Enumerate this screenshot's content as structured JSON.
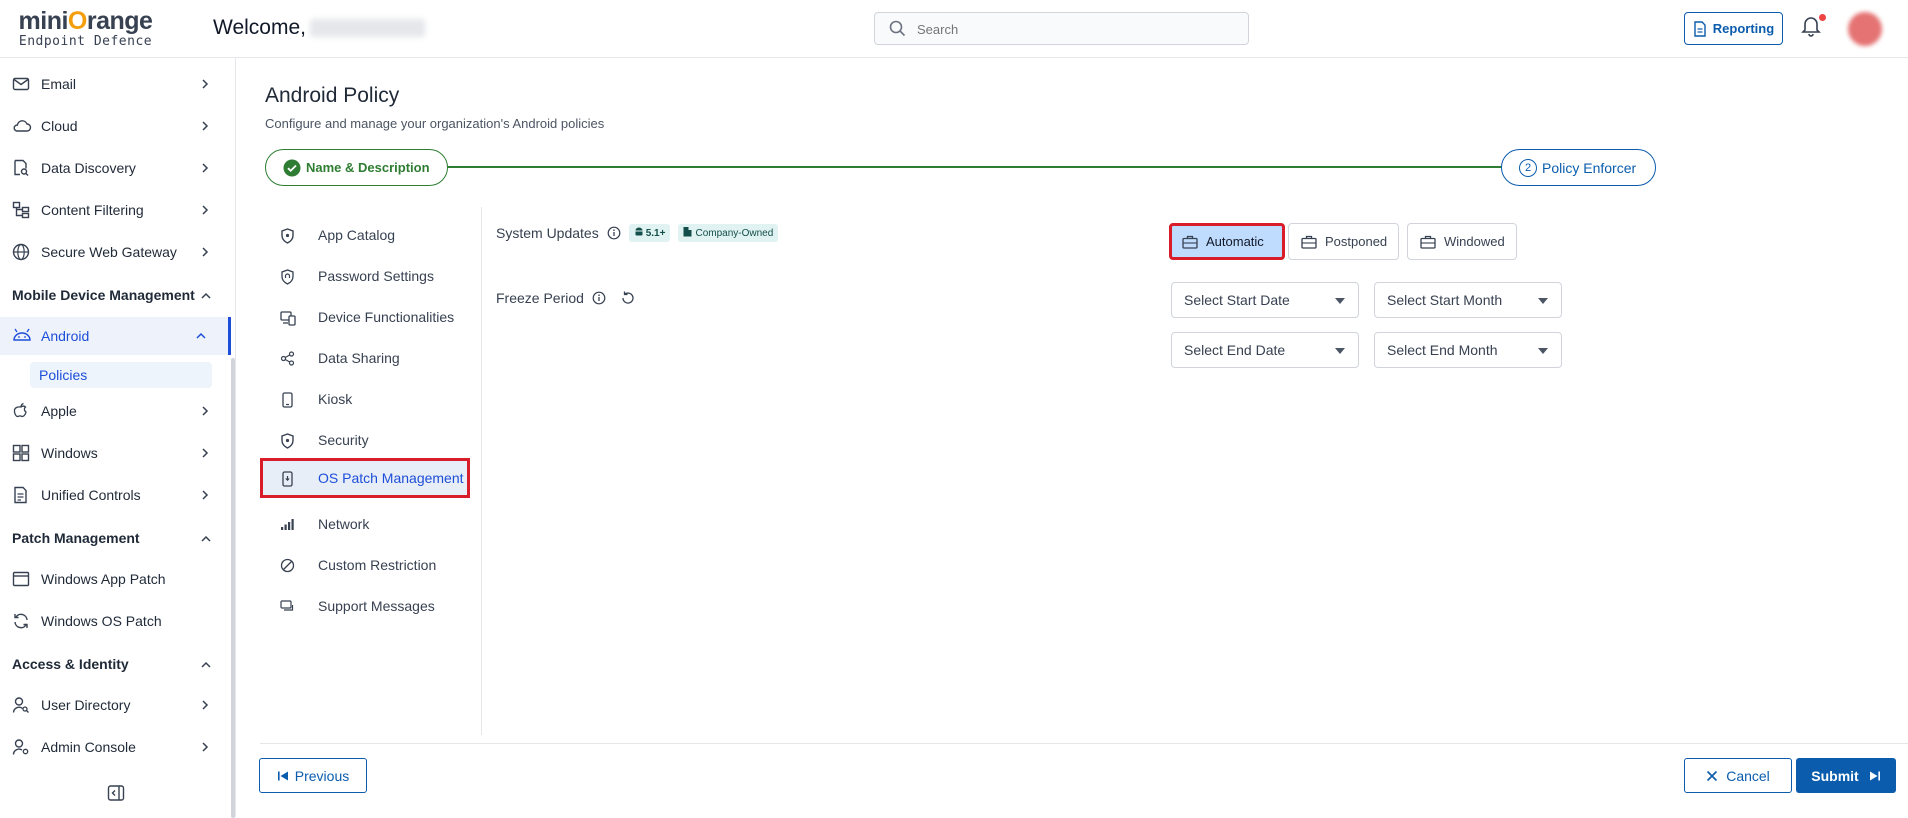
{
  "header": {
    "logo_main_a": "mini",
    "logo_main_o": "O",
    "logo_main_b": "range",
    "logo_sub": "Endpoint Defence",
    "welcome": "Welcome,",
    "search_placeholder": "Search",
    "reporting_label": "Reporting"
  },
  "sidebar": {
    "items_top": [
      {
        "label": "Email",
        "icon": "mail-icon"
      },
      {
        "label": "Cloud",
        "icon": "cloud-icon"
      },
      {
        "label": "Data Discovery",
        "icon": "data-discovery-icon"
      },
      {
        "label": "Content Filtering",
        "icon": "content-filter-icon"
      },
      {
        "label": "Secure Web Gateway",
        "icon": "globe-icon"
      }
    ],
    "section_mdm": "Mobile Device Management",
    "android_label": "Android",
    "policies_label": "Policies",
    "mdm_items": [
      {
        "label": "Apple",
        "icon": "apple-icon"
      },
      {
        "label": "Windows",
        "icon": "windows-icon"
      },
      {
        "label": "Unified Controls",
        "icon": "unified-controls-icon"
      }
    ],
    "section_patch": "Patch Management",
    "patch_items": [
      {
        "label": "Windows App Patch",
        "icon": "app-window-icon"
      },
      {
        "label": "Windows OS Patch",
        "icon": "refresh-icon"
      }
    ],
    "section_access": "Access & Identity",
    "access_items": [
      {
        "label": "User Directory",
        "icon": "user-directory-icon"
      },
      {
        "label": "Admin Console",
        "icon": "admin-console-icon"
      }
    ]
  },
  "page": {
    "title": "Android Policy",
    "subtitle": "Configure and manage your organization's Android policies"
  },
  "stepper": {
    "step1_label": "Name & Description",
    "step2_num": "2",
    "step2_label": "Policy Enforcer"
  },
  "policy_menu": [
    {
      "label": "App Catalog",
      "icon": "shield-icon"
    },
    {
      "label": "Password Settings",
      "icon": "fingerprint-icon"
    },
    {
      "label": "Device Functionalities",
      "icon": "devices-icon"
    },
    {
      "label": "Data Sharing",
      "icon": "share-icon"
    },
    {
      "label": "Kiosk",
      "icon": "kiosk-icon"
    },
    {
      "label": "Security",
      "icon": "security-shield-icon"
    },
    {
      "label": "OS Patch Management",
      "icon": "phone-patch-icon"
    },
    {
      "label": "Network",
      "icon": "signal-icon"
    },
    {
      "label": "Custom Restriction",
      "icon": "block-icon"
    },
    {
      "label": "Support Messages",
      "icon": "message-icon"
    }
  ],
  "system_updates": {
    "label": "System Updates",
    "version_badge": "5.1+",
    "owner_badge": "Company-Owned",
    "options": [
      "Automatic",
      "Postponed",
      "Windowed"
    ],
    "selected": "Automatic"
  },
  "freeze_period": {
    "label": "Freeze Period",
    "start_date_placeholder": "Select Start Date",
    "start_month_placeholder": "Select Start Month",
    "end_date_placeholder": "Select End Date",
    "end_month_placeholder": "Select End Month"
  },
  "footer": {
    "previous_label": "Previous",
    "cancel_label": "Cancel",
    "submit_label": "Submit"
  },
  "colors": {
    "primary": "#0b5cad",
    "success": "#2e7d32",
    "highlight": "#d91c2a",
    "selected_bg": "#bfdbfe"
  }
}
